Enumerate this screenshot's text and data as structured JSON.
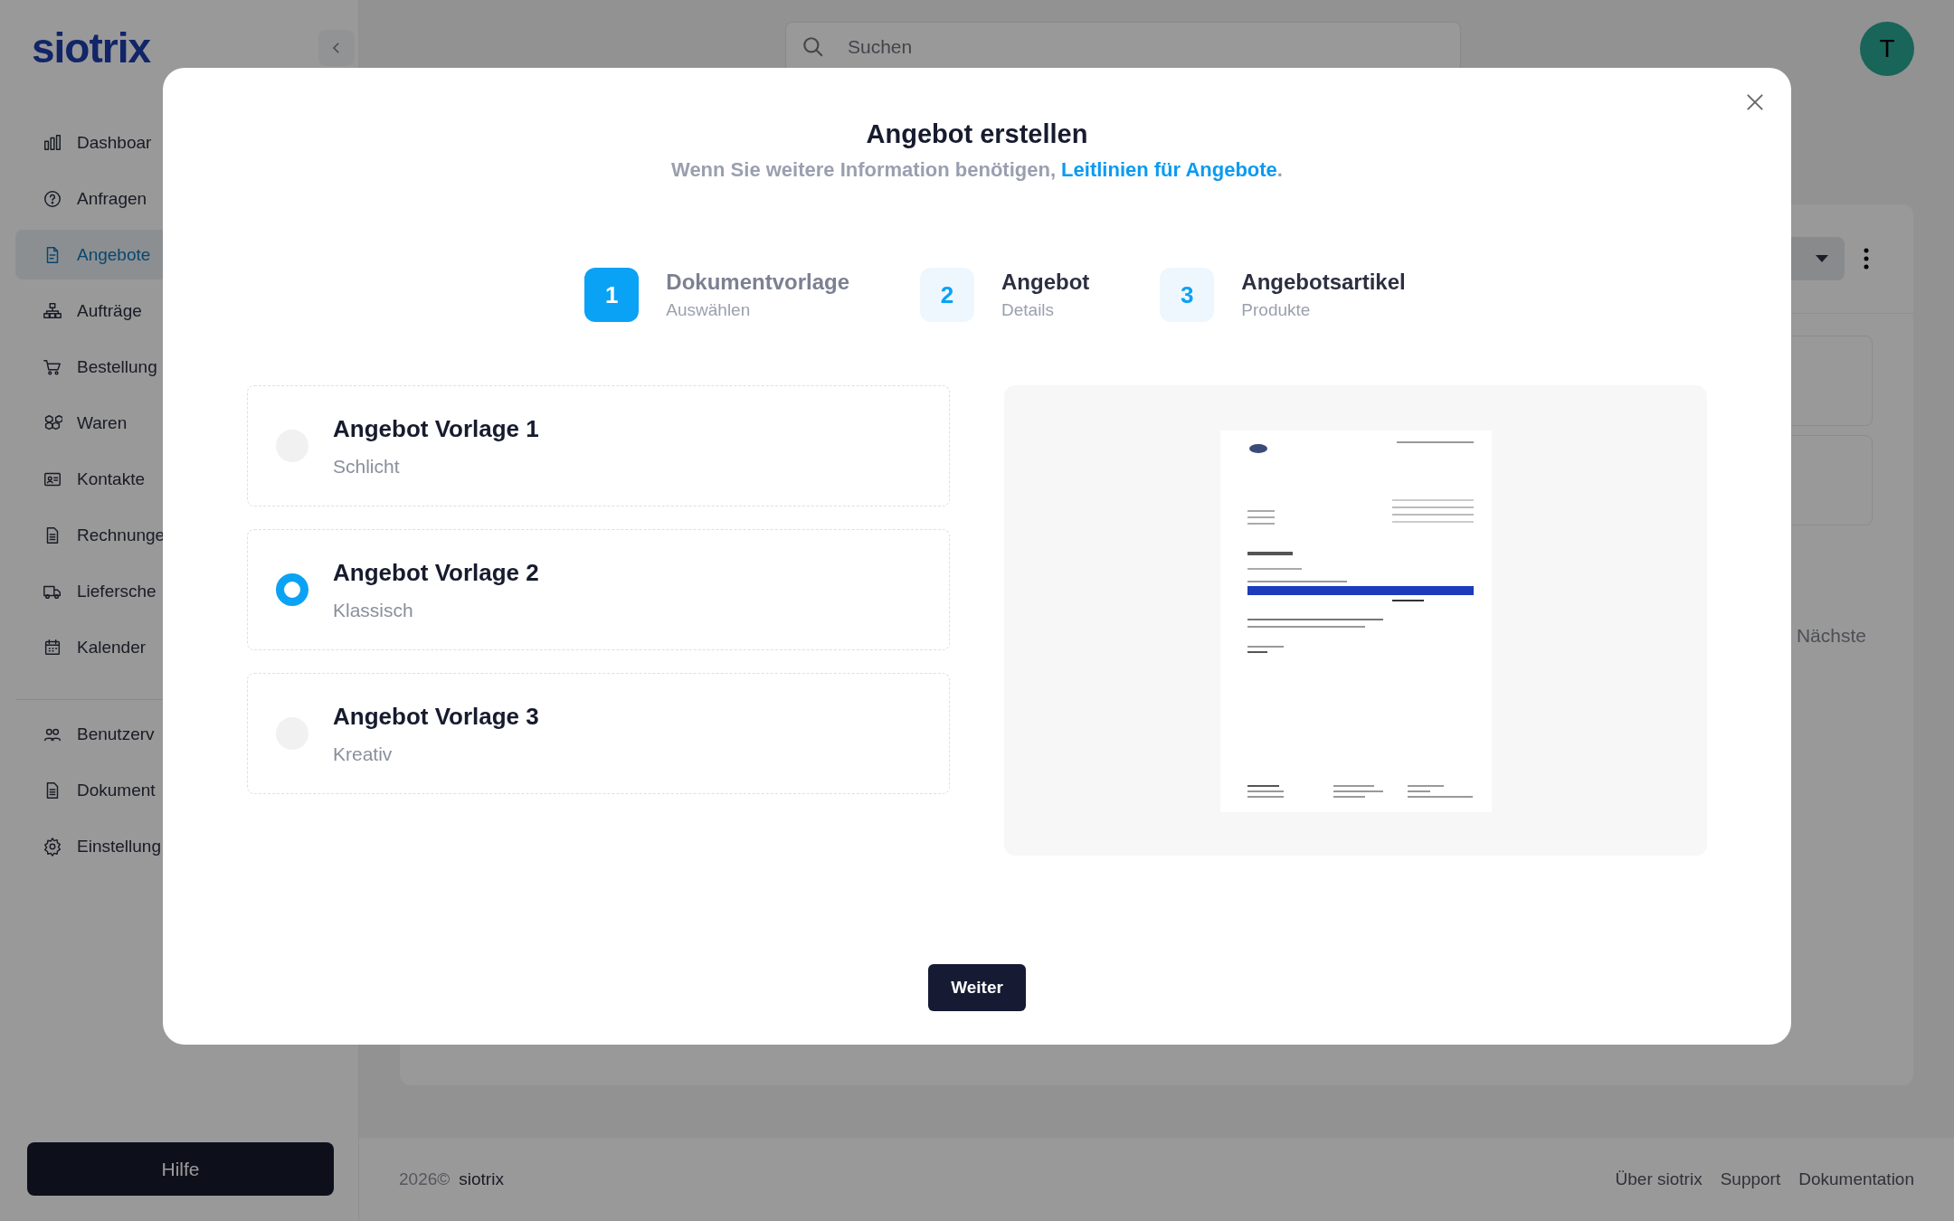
{
  "sidebar": {
    "logo": "siotrix",
    "groups": [
      [
        {
          "label": "Dashboar",
          "selected": false
        },
        {
          "label": "Anfragen",
          "selected": false
        },
        {
          "label": "Angebote",
          "selected": true
        },
        {
          "label": "Aufträge",
          "selected": false
        },
        {
          "label": "Bestellung",
          "selected": false
        },
        {
          "label": "Waren",
          "selected": false
        },
        {
          "label": "Kontakte",
          "selected": false
        },
        {
          "label": "Rechnunge",
          "selected": false
        },
        {
          "label": "Liefersche",
          "selected": false
        },
        {
          "label": "Kalender",
          "selected": false
        }
      ],
      [
        {
          "label": "Benutzerv",
          "selected": false
        },
        {
          "label": "Dokument",
          "selected": false
        },
        {
          "label": "Einstellung",
          "selected": false
        }
      ]
    ],
    "help_button": "Hilfe"
  },
  "header": {
    "search": {
      "placeholder": "Suchen"
    },
    "avatar": "T"
  },
  "background_card": {
    "pager_label": "Nächste"
  },
  "footer": {
    "year": "2026©",
    "brand": "siotrix",
    "links": [
      "Über siotrix",
      "Support",
      "Dokumentation"
    ]
  },
  "modal": {
    "title": "Angebot erstellen",
    "subtitle": {
      "text": "Wenn Sie weitere Information benötigen, ",
      "link": "Leitlinien für Angebote",
      "end": "."
    },
    "steps": [
      {
        "number": "1",
        "title": "Dokumentvorlage",
        "subtitle": "Auswählen",
        "active": true
      },
      {
        "number": "2",
        "title": "Angebot",
        "subtitle": "Details",
        "active": false
      },
      {
        "number": "3",
        "title": "Angebotsartikel",
        "subtitle": "Produkte",
        "active": false
      }
    ],
    "templates": [
      {
        "title": "Angebot Vorlage 1",
        "subtitle": "Schlicht",
        "selected": false
      },
      {
        "title": "Angebot Vorlage 2",
        "subtitle": "Klassisch",
        "selected": true
      },
      {
        "title": "Angebot Vorlage 3",
        "subtitle": "Kreativ",
        "selected": false
      }
    ],
    "button": "Weiter"
  }
}
